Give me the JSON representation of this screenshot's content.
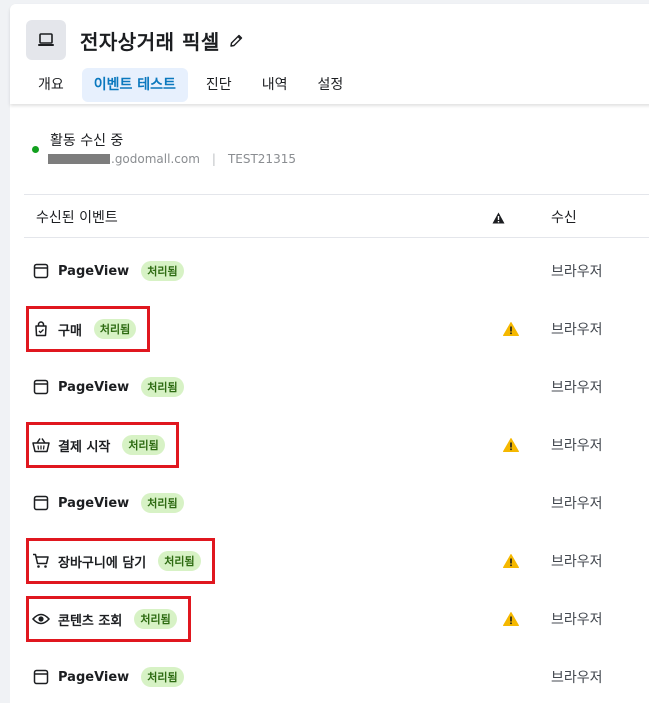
{
  "header": {
    "app_icon": "laptop-icon",
    "title": "전자상거래 픽셀",
    "edit_icon": "pencil-icon",
    "tabs": [
      {
        "label": "개요",
        "active": false
      },
      {
        "label": "이벤트 테스트",
        "active": true
      },
      {
        "label": "진단",
        "active": false
      },
      {
        "label": "내역",
        "active": false
      },
      {
        "label": "설정",
        "active": false
      }
    ]
  },
  "status": {
    "text": "활동 수신 중",
    "domain": ".godomall.com",
    "separator": "|",
    "code": "TEST21315",
    "dot_color": "#12a01e"
  },
  "table": {
    "col_events": "수신된 이벤트",
    "col_warning_icon": "warning-icon",
    "col_received": "수신",
    "status_badge_color": "#d7f2c5",
    "warning_color": "#f5b800",
    "rows": [
      {
        "icon": "browser-window-icon",
        "name": "PageView",
        "badge": "처리됨",
        "warning": false,
        "received": "브라우저",
        "highlighted": false
      },
      {
        "icon": "shopping-bag-icon",
        "name": "구매",
        "badge": "처리됨",
        "warning": true,
        "received": "브라우저",
        "highlighted": true
      },
      {
        "icon": "browser-window-icon",
        "name": "PageView",
        "badge": "처리됨",
        "warning": false,
        "received": "브라우저",
        "highlighted": false
      },
      {
        "icon": "basket-icon",
        "name": "결제 시작",
        "badge": "처리됨",
        "warning": true,
        "received": "브라우저",
        "highlighted": true
      },
      {
        "icon": "browser-window-icon",
        "name": "PageView",
        "badge": "처리됨",
        "warning": false,
        "received": "브라우저",
        "highlighted": false
      },
      {
        "icon": "cart-icon",
        "name": "장바구니에 담기",
        "badge": "처리됨",
        "warning": true,
        "received": "브라우저",
        "highlighted": true
      },
      {
        "icon": "eye-icon",
        "name": "콘텐츠 조회",
        "badge": "처리됨",
        "warning": true,
        "received": "브라우저",
        "highlighted": true
      },
      {
        "icon": "browser-window-icon",
        "name": "PageView",
        "badge": "처리됨",
        "warning": false,
        "received": "브라우저",
        "highlighted": false
      }
    ]
  },
  "annotation_color": "#e0171f"
}
